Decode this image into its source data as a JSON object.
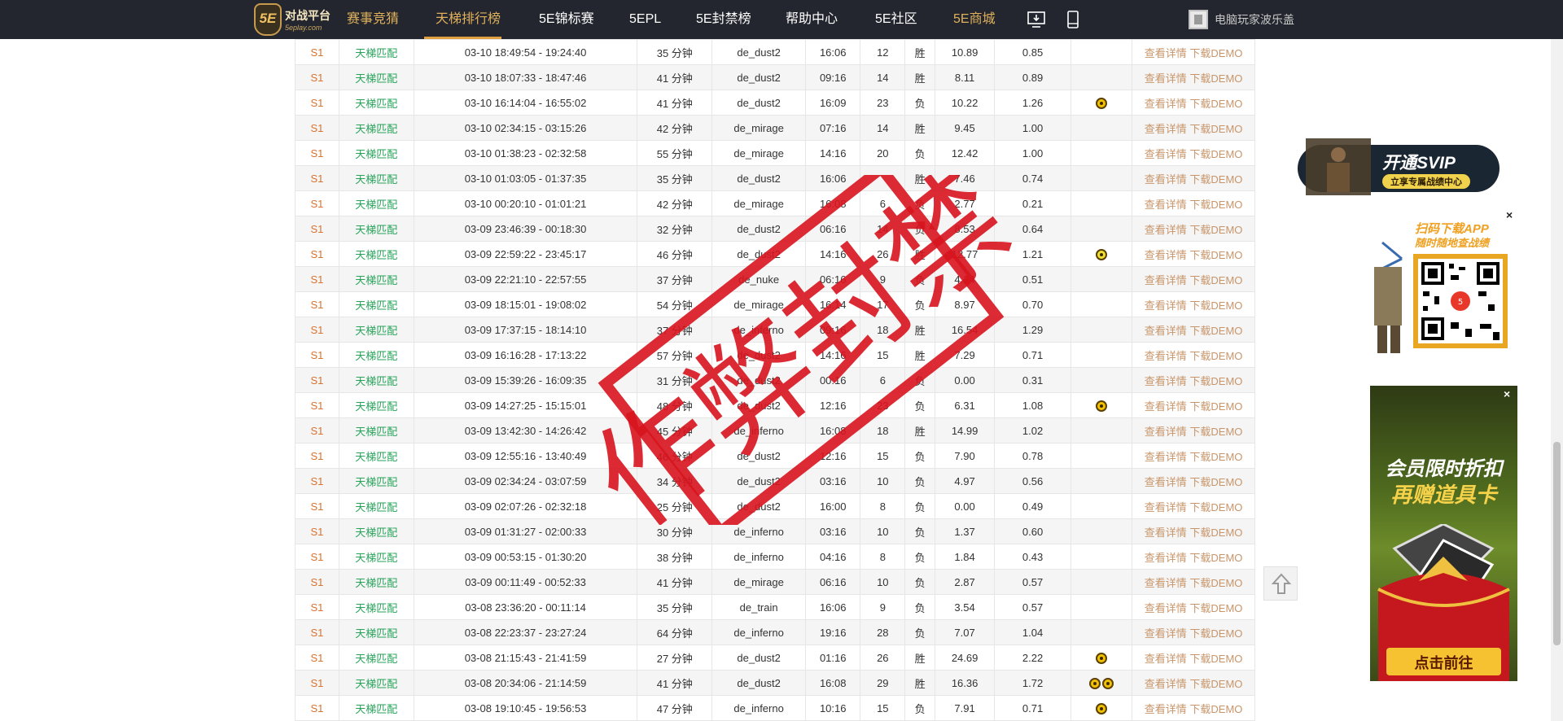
{
  "nav": {
    "logo_title": "对战平台",
    "logo_sub": "5eplay.com",
    "logo_badge": "5E",
    "items": [
      "赛事竞猜",
      "天梯排行榜",
      "5E锦标赛",
      "5EPL",
      "5E封禁榜",
      "帮助中心",
      "5E社区",
      "5E商城"
    ],
    "username": "电脑玩家波乐盖"
  },
  "table": {
    "actions": {
      "details": "查看详情",
      "download": "下载DEMO"
    },
    "rows": [
      {
        "season": "S1",
        "type": "天梯匹配",
        "time": "03-10 18:49:54 - 19:24:40",
        "duration": "35 分钟",
        "map": "de_dust2",
        "score": "16:06",
        "kills": "12",
        "result": "胜",
        "rating": "10.89",
        "kd": "0.85",
        "medals": ""
      },
      {
        "season": "S1",
        "type": "天梯匹配",
        "time": "03-10 18:07:33 - 18:47:46",
        "duration": "41 分钟",
        "map": "de_dust2",
        "score": "09:16",
        "kills": "14",
        "result": "胜",
        "rating": "8.11",
        "kd": "0.89",
        "medals": ""
      },
      {
        "season": "S1",
        "type": "天梯匹配",
        "time": "03-10 16:14:04 - 16:55:02",
        "duration": "41 分钟",
        "map": "de_dust2",
        "score": "16:09",
        "kills": "23",
        "result": "负",
        "rating": "10.22",
        "kd": "1.26",
        "medals": "medal"
      },
      {
        "season": "S1",
        "type": "天梯匹配",
        "time": "03-10 02:34:15 - 03:15:26",
        "duration": "42 分钟",
        "map": "de_mirage",
        "score": "07:16",
        "kills": "14",
        "result": "胜",
        "rating": "9.45",
        "kd": "1.00",
        "medals": ""
      },
      {
        "season": "S1",
        "type": "天梯匹配",
        "time": "03-10 01:38:23 - 02:32:58",
        "duration": "55 分钟",
        "map": "de_mirage",
        "score": "14:16",
        "kills": "20",
        "result": "负",
        "rating": "12.42",
        "kd": "1.00",
        "medals": ""
      },
      {
        "season": "S1",
        "type": "天梯匹配",
        "time": "03-10 01:03:05 - 01:37:35",
        "duration": "35 分钟",
        "map": "de_dust2",
        "score": "16:06",
        "kills": "",
        "result": "胜",
        "rating": "7.46",
        "kd": "0.74",
        "medals": ""
      },
      {
        "season": "S1",
        "type": "天梯匹配",
        "time": "03-10 00:20:10 - 01:01:21",
        "duration": "42 分钟",
        "map": "de_mirage",
        "score": "16:08",
        "kills": "6",
        "result": "负",
        "rating": "2.77",
        "kd": "0.21",
        "medals": ""
      },
      {
        "season": "S1",
        "type": "天梯匹配",
        "time": "03-09 23:46:39 - 00:18:30",
        "duration": "32 分钟",
        "map": "de_dust2",
        "score": "06:16",
        "kills": "14",
        "result": "负",
        "rating": "8.53",
        "kd": "0.64",
        "medals": ""
      },
      {
        "season": "S1",
        "type": "天梯匹配",
        "time": "03-09 22:59:22 - 23:45:17",
        "duration": "46 分钟",
        "map": "de_dust2",
        "score": "14:16",
        "kills": "26",
        "result": "胜",
        "rating": "12.77",
        "kd": "1.21",
        "medals": "skull"
      },
      {
        "season": "S1",
        "type": "天梯匹配",
        "time": "03-09 22:21:10 - 22:57:55",
        "duration": "37 分钟",
        "map": "de_nuke",
        "score": "06:16",
        "kills": "9",
        "result": "负",
        "rating": "4.34",
        "kd": "0.51",
        "medals": ""
      },
      {
        "season": "S1",
        "type": "天梯匹配",
        "time": "03-09 18:15:01 - 19:08:02",
        "duration": "54 分钟",
        "map": "de_mirage",
        "score": "16:14",
        "kills": "17",
        "result": "负",
        "rating": "8.97",
        "kd": "0.70",
        "medals": ""
      },
      {
        "season": "S1",
        "type": "天梯匹配",
        "time": "03-09 17:37:15 - 18:14:10",
        "duration": "37 分钟",
        "map": "de_inferno",
        "score": "09:16",
        "kills": "18",
        "result": "胜",
        "rating": "16.54",
        "kd": "1.29",
        "medals": ""
      },
      {
        "season": "S1",
        "type": "天梯匹配",
        "time": "03-09 16:16:28 - 17:13:22",
        "duration": "57 分钟",
        "map": "de_dust2",
        "score": "14:16",
        "kills": "15",
        "result": "胜",
        "rating": "7.29",
        "kd": "0.71",
        "medals": ""
      },
      {
        "season": "S1",
        "type": "天梯匹配",
        "time": "03-09 15:39:26 - 16:09:35",
        "duration": "31 分钟",
        "map": "de_dust2",
        "score": "00:16",
        "kills": "6",
        "result": "负",
        "rating": "0.00",
        "kd": "0.31",
        "medals": ""
      },
      {
        "season": "S1",
        "type": "天梯匹配",
        "time": "03-09 14:27:25 - 15:15:01",
        "duration": "48 分钟",
        "map": "de_dust2",
        "score": "12:16",
        "kills": "23",
        "result": "负",
        "rating": "6.31",
        "kd": "1.08",
        "medals": "medal"
      },
      {
        "season": "S1",
        "type": "天梯匹配",
        "time": "03-09 13:42:30 - 14:26:42",
        "duration": "45 分钟",
        "map": "de_inferno",
        "score": "16:08",
        "kills": "18",
        "result": "胜",
        "rating": "14.99",
        "kd": "1.02",
        "medals": ""
      },
      {
        "season": "S1",
        "type": "天梯匹配",
        "time": "03-09 12:55:16 - 13:40:49",
        "duration": "46 分钟",
        "map": "de_dust2",
        "score": "12:16",
        "kills": "15",
        "result": "负",
        "rating": "7.90",
        "kd": "0.78",
        "medals": ""
      },
      {
        "season": "S1",
        "type": "天梯匹配",
        "time": "03-09 02:34:24 - 03:07:59",
        "duration": "34 分钟",
        "map": "de_dust2",
        "score": "03:16",
        "kills": "10",
        "result": "负",
        "rating": "4.97",
        "kd": "0.56",
        "medals": ""
      },
      {
        "season": "S1",
        "type": "天梯匹配",
        "time": "03-09 02:07:26 - 02:32:18",
        "duration": "25 分钟",
        "map": "de_dust2",
        "score": "16:00",
        "kills": "8",
        "result": "负",
        "rating": "0.00",
        "kd": "0.49",
        "medals": ""
      },
      {
        "season": "S1",
        "type": "天梯匹配",
        "time": "03-09 01:31:27 - 02:00:33",
        "duration": "30 分钟",
        "map": "de_inferno",
        "score": "03:16",
        "kills": "10",
        "result": "负",
        "rating": "1.37",
        "kd": "0.60",
        "medals": ""
      },
      {
        "season": "S1",
        "type": "天梯匹配",
        "time": "03-09 00:53:15 - 01:30:20",
        "duration": "38 分钟",
        "map": "de_inferno",
        "score": "04:16",
        "kills": "8",
        "result": "负",
        "rating": "1.84",
        "kd": "0.43",
        "medals": ""
      },
      {
        "season": "S1",
        "type": "天梯匹配",
        "time": "03-09 00:11:49 - 00:52:33",
        "duration": "41 分钟",
        "map": "de_mirage",
        "score": "06:16",
        "kills": "10",
        "result": "负",
        "rating": "2.87",
        "kd": "0.57",
        "medals": ""
      },
      {
        "season": "S1",
        "type": "天梯匹配",
        "time": "03-08 23:36:20 - 00:11:14",
        "duration": "35 分钟",
        "map": "de_train",
        "score": "16:06",
        "kills": "9",
        "result": "负",
        "rating": "3.54",
        "kd": "0.57",
        "medals": ""
      },
      {
        "season": "S1",
        "type": "天梯匹配",
        "time": "03-08 22:23:37 - 23:27:24",
        "duration": "64 分钟",
        "map": "de_inferno",
        "score": "19:16",
        "kills": "28",
        "result": "负",
        "rating": "7.07",
        "kd": "1.04",
        "medals": ""
      },
      {
        "season": "S1",
        "type": "天梯匹配",
        "time": "03-08 21:15:43 - 21:41:59",
        "duration": "27 分钟",
        "map": "de_dust2",
        "score": "01:16",
        "kills": "26",
        "result": "胜",
        "rating": "24.69",
        "kd": "2.22",
        "medals": "medal"
      },
      {
        "season": "S1",
        "type": "天梯匹配",
        "time": "03-08 20:34:06 - 21:14:59",
        "duration": "41 分钟",
        "map": "de_dust2",
        "score": "16:08",
        "kills": "29",
        "result": "胜",
        "rating": "16.36",
        "kd": "1.72",
        "medals": "medal2"
      },
      {
        "season": "S1",
        "type": "天梯匹配",
        "time": "03-08 19:10:45 - 19:56:53",
        "duration": "47 分钟",
        "map": "de_inferno",
        "score": "10:16",
        "kills": "15",
        "result": "负",
        "rating": "7.91",
        "kd": "0.71",
        "medals": "medal"
      }
    ]
  },
  "stamp": {
    "text": "作弊封禁",
    "color": "#d8141e"
  },
  "ads": {
    "svip_title": "开通SVIP",
    "svip_sub": "立享专属战绩中心",
    "qr_title": "扫码下载APP",
    "qr_sub": "随时随地查战绩",
    "promo_line1": "会员限时折扣",
    "promo_line2": "再赠道具卡",
    "promo_button": "点击前往",
    "close": "×"
  },
  "colors": {
    "nav_bg": "#23262e",
    "accent_gold": "#e0b15c",
    "match_type_green": "#27a35a",
    "season_orange": "#d9722e",
    "action_tan": "#c8956a"
  },
  "icons": [
    "logo-5e",
    "monitor-download-icon",
    "phone-icon",
    "avatar",
    "medal-icon",
    "skull-icon",
    "scroll-top-arrow-icon",
    "close-icon"
  ]
}
